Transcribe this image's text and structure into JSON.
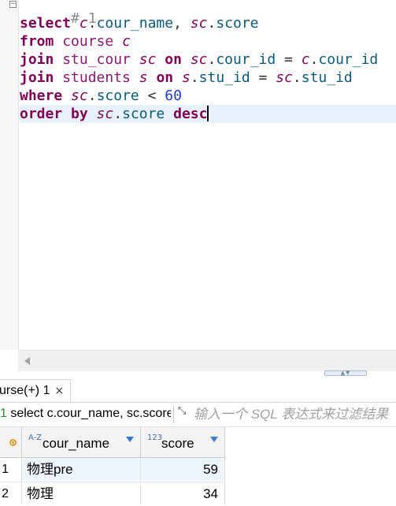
{
  "editor": {
    "fold_glyph": "−",
    "comment": "# 1",
    "lines": [
      [
        {
          "t": "select",
          "c": "kw"
        },
        {
          "t": " "
        },
        {
          "t": "c",
          "c": "alias"
        },
        {
          "t": "."
        },
        {
          "t": "cour_name",
          "c": "col"
        },
        {
          "t": ", "
        },
        {
          "t": "sc",
          "c": "alias"
        },
        {
          "t": "."
        },
        {
          "t": "score",
          "c": "col"
        }
      ],
      [
        {
          "t": "from",
          "c": "kw"
        },
        {
          "t": " "
        },
        {
          "t": "course",
          "c": "tbl"
        },
        {
          "t": " "
        },
        {
          "t": "c",
          "c": "alias"
        }
      ],
      [
        {
          "t": "join",
          "c": "kw"
        },
        {
          "t": " "
        },
        {
          "t": "stu_cour",
          "c": "tbl"
        },
        {
          "t": " "
        },
        {
          "t": "sc",
          "c": "alias"
        },
        {
          "t": " "
        },
        {
          "t": "on",
          "c": "kw"
        },
        {
          "t": " "
        },
        {
          "t": "sc",
          "c": "alias"
        },
        {
          "t": "."
        },
        {
          "t": "cour_id",
          "c": "col"
        },
        {
          "t": " = "
        },
        {
          "t": "c",
          "c": "alias"
        },
        {
          "t": "."
        },
        {
          "t": "cour_id",
          "c": "col"
        }
      ],
      [
        {
          "t": "join",
          "c": "kw"
        },
        {
          "t": " "
        },
        {
          "t": "students",
          "c": "tbl"
        },
        {
          "t": " "
        },
        {
          "t": "s",
          "c": "alias"
        },
        {
          "t": " "
        },
        {
          "t": "on",
          "c": "kw"
        },
        {
          "t": " "
        },
        {
          "t": "s",
          "c": "alias"
        },
        {
          "t": "."
        },
        {
          "t": "stu_id",
          "c": "col"
        },
        {
          "t": " = "
        },
        {
          "t": "sc",
          "c": "alias"
        },
        {
          "t": "."
        },
        {
          "t": "stu_id",
          "c": "col"
        }
      ],
      [
        {
          "t": "where",
          "c": "kw"
        },
        {
          "t": " "
        },
        {
          "t": "sc",
          "c": "alias"
        },
        {
          "t": "."
        },
        {
          "t": "score",
          "c": "col"
        },
        {
          "t": " < "
        },
        {
          "t": "60",
          "c": "num"
        }
      ],
      [
        {
          "t": "order by",
          "c": "kw"
        },
        {
          "t": " "
        },
        {
          "t": "sc",
          "c": "alias"
        },
        {
          "t": "."
        },
        {
          "t": "score",
          "c": "col"
        },
        {
          "t": " "
        },
        {
          "t": "desc",
          "c": "kw"
        }
      ]
    ]
  },
  "results": {
    "tab_label": "urse(+) 1",
    "tab_close": "×",
    "query_prefix": "1",
    "query_text": " select c.cour_name, sc.score",
    "filter_placeholder": "输入一个 SQL 表达式来过滤结果",
    "sash_glyph": "▲▼",
    "columns": [
      {
        "type_glyph": "A-Z",
        "name": "cour_name"
      },
      {
        "type_glyph": "123",
        "name": "score"
      }
    ],
    "rows": [
      {
        "num": "1",
        "cour_name": "物理pre",
        "score": "59"
      },
      {
        "num": "2",
        "cour_name": "物理",
        "score": "34"
      }
    ]
  },
  "colors": {
    "keyword": "#7f0055",
    "table": "#8a1a70",
    "column": "#0a5a78",
    "number": "#1f3ad6",
    "current_line": "#e8f2fe",
    "selected_row": "#eef5fc"
  }
}
